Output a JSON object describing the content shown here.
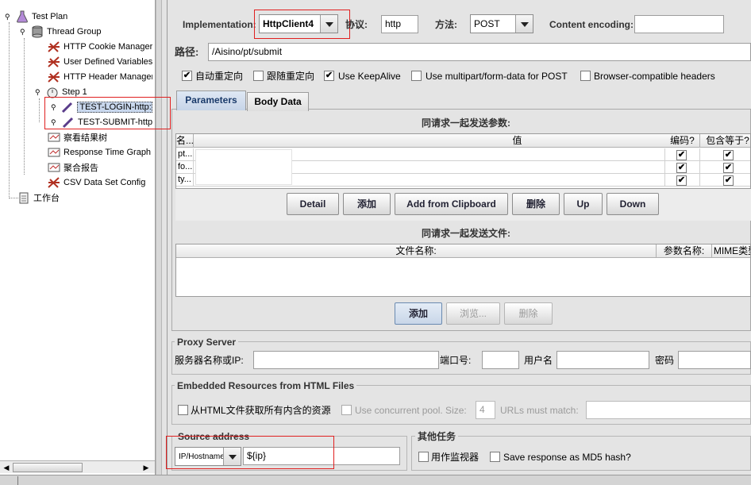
{
  "tree": {
    "test_plan": "Test Plan",
    "thread_group": "Thread Group",
    "cookie_manager": "HTTP Cookie Manager",
    "user_vars": "User Defined Variables",
    "header_manager": "HTTP Header Manager",
    "step1": "Step 1",
    "login": "TEST-LOGIN-http:/",
    "submit": "TEST-SUBMIT-http",
    "result_tree": "察看结果树",
    "resp_graph": "Response Time Graph",
    "aggregate": "聚合报告",
    "csv": "CSV Data Set Config",
    "workbench": "工作台"
  },
  "request": {
    "impl_label": "Implementation:",
    "impl_value": "HttpClient4",
    "protocol_label": "协议:",
    "protocol_value": "http",
    "method_label": "方法:",
    "method_value": "POST",
    "encoding_label": "Content encoding:",
    "encoding_value": "",
    "path_label": "路径:",
    "path_value": "/Aisino/pt/submit"
  },
  "options": {
    "auto_redirect": {
      "label": "自动重定向",
      "checked": true
    },
    "follow_redirect": {
      "label": "跟随重定向",
      "checked": false
    },
    "keepalive": {
      "label": "Use KeepAlive",
      "checked": true
    },
    "multipart": {
      "label": "Use multipart/form-data for POST",
      "checked": false
    },
    "browser_headers": {
      "label": "Browser-compatible headers",
      "checked": false
    }
  },
  "tabs": {
    "parameters": "Parameters",
    "body": "Body Data"
  },
  "params": {
    "title": "同请求一起发送参数:",
    "col_name": "名...",
    "col_value": "值",
    "col_encode": "编码?",
    "col_include": "包含等于?",
    "rows": [
      {
        "name": "pt...",
        "value": "",
        "encode": true,
        "include": true
      },
      {
        "name": "fo...",
        "value": "",
        "encode": true,
        "include": true
      },
      {
        "name": "ty...",
        "value": "",
        "encode": true,
        "include": true
      }
    ]
  },
  "param_buttons": {
    "detail": "Detail",
    "add": "添加",
    "clipboard": "Add from Clipboard",
    "delete": "删除",
    "up": "Up",
    "down": "Down"
  },
  "files": {
    "title": "同请求一起发送文件:",
    "col_path": "文件名称:",
    "col_param": "参数名称:",
    "col_mime": "MIME类型"
  },
  "file_buttons": {
    "add": "添加",
    "browse": "浏览...",
    "delete": "删除"
  },
  "proxy": {
    "title": "Proxy Server",
    "server_label": "服务器名称或IP:",
    "port_label": "端口号:",
    "user_label": "用户名",
    "password_label": "密码"
  },
  "embedded": {
    "title": "Embedded Resources from HTML Files",
    "retrieve": {
      "label": "从HTML文件获取所有内含的资源",
      "checked": false
    },
    "concurrent": {
      "label": "Use concurrent pool. Size:",
      "checked": false
    },
    "pool_size": "4",
    "urls_label": "URLs must match:"
  },
  "source": {
    "title": "Source address",
    "type_value": "IP/Hostname",
    "value": "${ip}"
  },
  "other": {
    "title": "其他任务",
    "monitor": {
      "label": "用作监视器",
      "checked": false
    },
    "md5": {
      "label": "Save response as MD5 hash?",
      "checked": false
    }
  },
  "colors": {
    "selection": "#c9d8ee",
    "highlight_box": "#e02020",
    "panel_bg": "#e4e4e4"
  },
  "icons": [
    "flask-icon",
    "spool-icon",
    "broken-tools-icon",
    "dropper-icon",
    "chart-icon",
    "clipboard-icon"
  ]
}
